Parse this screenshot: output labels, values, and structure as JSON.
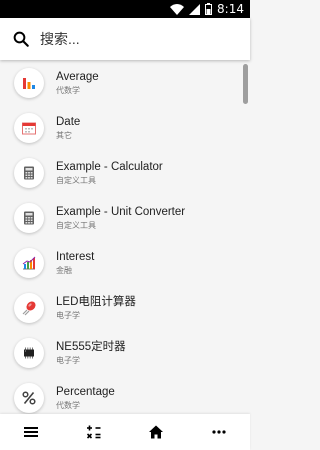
{
  "status_bar": {
    "time": "8:14"
  },
  "search": {
    "placeholder": "搜索..."
  },
  "items": [
    {
      "title": "Average",
      "subtitle": "代数学",
      "icon": "bar-chart-icon"
    },
    {
      "title": "Date",
      "subtitle": "其它",
      "icon": "calendar-icon"
    },
    {
      "title": "Example - Calculator",
      "subtitle": "自定义工具",
      "icon": "calculator-icon"
    },
    {
      "title": "Example - Unit Converter",
      "subtitle": "自定义工具",
      "icon": "calculator-icon"
    },
    {
      "title": "Interest",
      "subtitle": "金融",
      "icon": "growth-chart-icon"
    },
    {
      "title": "LED电阻计算器",
      "subtitle": "电子学",
      "icon": "led-icon"
    },
    {
      "title": "NE555定时器",
      "subtitle": "电子学",
      "icon": "chip-icon"
    },
    {
      "title": "Percentage",
      "subtitle": "代数学",
      "icon": "percent-icon"
    }
  ],
  "bottom_nav": [
    {
      "icon": "menu-icon"
    },
    {
      "icon": "calculator-ops-icon"
    },
    {
      "icon": "home-icon"
    },
    {
      "icon": "more-icon"
    }
  ]
}
